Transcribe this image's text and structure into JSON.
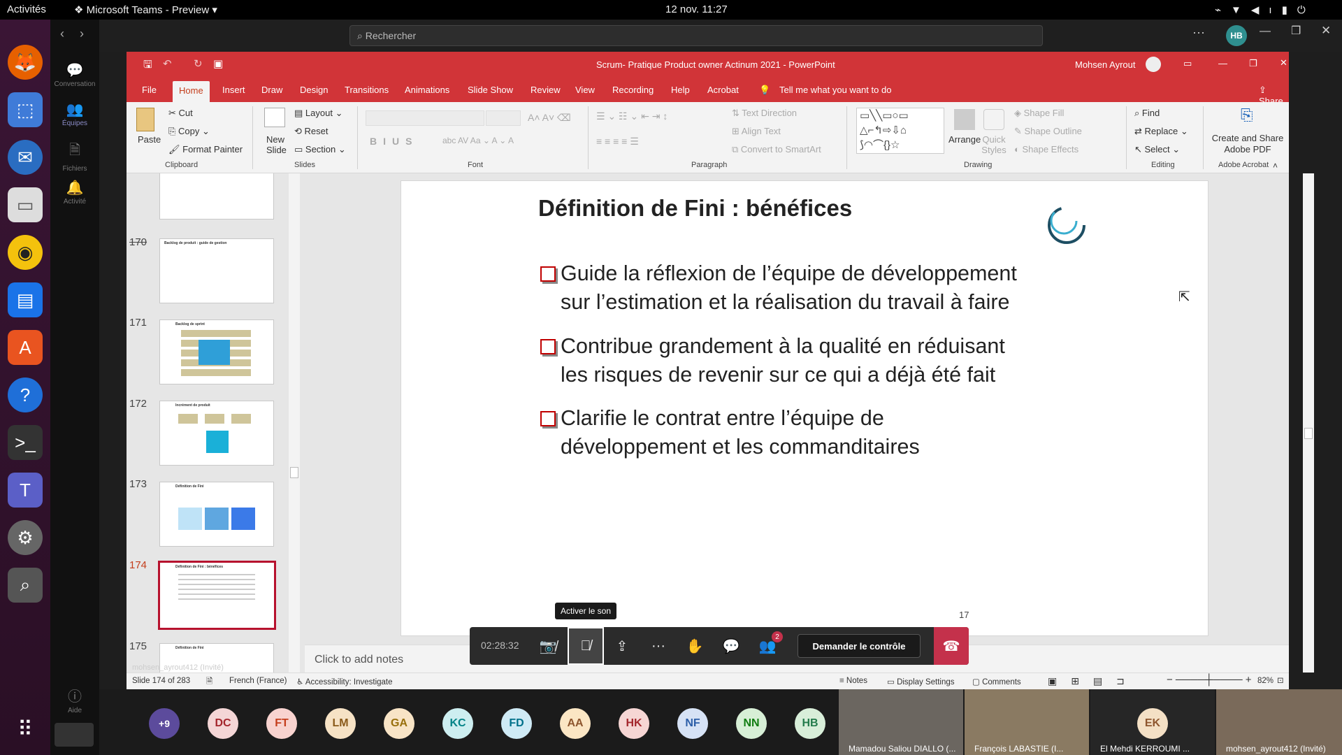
{
  "topbar": {
    "activities": "Activités",
    "app": "Microsoft Teams - Preview",
    "clock": "12 nov.  11:27"
  },
  "teams": {
    "search_placeholder": "Rechercher",
    "user_initials": "HB",
    "rail": [
      {
        "label": "Conversation",
        "icon": "chat-icon"
      },
      {
        "label": "Équipes",
        "icon": "teams-icon"
      },
      {
        "label": "Fichiers",
        "icon": "files-icon"
      },
      {
        "label": "Activité",
        "icon": "bell-icon"
      },
      {
        "label": "Aide",
        "icon": "help-icon"
      }
    ]
  },
  "ppt": {
    "title": "Scrum- Pratique Product owner Actinum 2021  -  PowerPoint",
    "user": "Mohsen Ayrout",
    "tabs": [
      "File",
      "Home",
      "Insert",
      "Draw",
      "Design",
      "Transitions",
      "Animations",
      "Slide Show",
      "Review",
      "View",
      "Recording",
      "Help",
      "Acrobat"
    ],
    "tell_me": "Tell me what you want to do",
    "share": "Share",
    "ribbon": {
      "paste": "Paste",
      "cut": "Cut",
      "copy": "Copy",
      "format_painter": "Format Painter",
      "clipboard": "Clipboard",
      "new_slide": "New Slide",
      "layout": "Layout",
      "reset": "Reset",
      "section": "Section",
      "slides": "Slides",
      "font": "Font",
      "text_direction": "Text Direction",
      "align_text": "Align Text",
      "convert_smartart": "Convert to SmartArt",
      "paragraph": "Paragraph",
      "arrange": "Arrange",
      "quick_styles": "Quick Styles",
      "shape_fill": "Shape Fill",
      "shape_outline": "Shape Outline",
      "shape_effects": "Shape Effects",
      "drawing": "Drawing",
      "find": "Find",
      "replace": "Replace",
      "select": "Select",
      "editing": "Editing",
      "create_share_pdf": "Create and Share Adobe PDF",
      "adobe_acrobat": "Adobe Acrobat"
    },
    "thumbs": [
      {
        "num": "170",
        "title": "Backlog de produit : guide de gestion"
      },
      {
        "num": "171",
        "title": "Backlog de sprint"
      },
      {
        "num": "172",
        "title": "Incrément de produit"
      },
      {
        "num": "173",
        "title": "Définition de Fini"
      },
      {
        "num": "174",
        "title": "Définition de Fini : bénéfices"
      },
      {
        "num": "175",
        "title": "Définition de Fini"
      }
    ],
    "slide": {
      "title": "Définition de Fini : bénéfices",
      "bullets": [
        [
          "Guide la réflexion de l’équipe de développement",
          "sur l’estimation et la réalisation du travail à faire"
        ],
        [
          "Contribue grandement à la qualité en réduisant",
          "les risques de revenir sur ce qui a déjà été fait"
        ],
        [
          "Clarifie le contrat entre l’équipe de",
          "développement et les commanditaires"
        ]
      ],
      "page_num": "17"
    },
    "notes_placeholder": "Click to add notes",
    "status": {
      "slide": "Slide 174 of 283",
      "lang": "French (France)",
      "accessibility": "Accessibility: Investigate",
      "notes": "Notes",
      "display": "Display Settings",
      "comments": "Comments",
      "zoom": "82%"
    }
  },
  "call": {
    "timer": "02:28:32",
    "tooltip": "Activer le son",
    "request_control": "Demander le contrôle",
    "participants_badge": "2",
    "presenter_label": "mohsen_ayrout412 (Invité)"
  },
  "gallery": {
    "overflow": "+9",
    "avatars": [
      {
        "initials": "DC",
        "bg": "#f4d6d6",
        "fg": "#a4262c"
      },
      {
        "initials": "FT",
        "bg": "#f8d3cf",
        "fg": "#c43e1c"
      },
      {
        "initials": "LM",
        "bg": "#f6e2c5",
        "fg": "#8a5a1a"
      },
      {
        "initials": "GA",
        "bg": "#f8e4c6",
        "fg": "#986f0b"
      },
      {
        "initials": "KC",
        "bg": "#cdeef0",
        "fg": "#038387"
      },
      {
        "initials": "FD",
        "bg": "#cfeaf5",
        "fg": "#00708a"
      },
      {
        "initials": "AA",
        "bg": "#fbe6c4",
        "fg": "#8e562e"
      },
      {
        "initials": "HK",
        "bg": "#f6d6d4",
        "fg": "#a4262c"
      },
      {
        "initials": "NF",
        "bg": "#d6e2f5",
        "fg": "#2c5ea8"
      },
      {
        "initials": "NN",
        "bg": "#d7efd6",
        "fg": "#107c10"
      },
      {
        "initials": "HB",
        "bg": "#d8eed9",
        "fg": "#237b4b"
      }
    ],
    "videos": [
      "Mamadou Saliou DIALLO (...",
      "François LABASTIE (I...",
      "El Mehdi KERROUMI ...",
      "mohsen_ayrout412 (Invité)"
    ],
    "ek": "EK"
  }
}
